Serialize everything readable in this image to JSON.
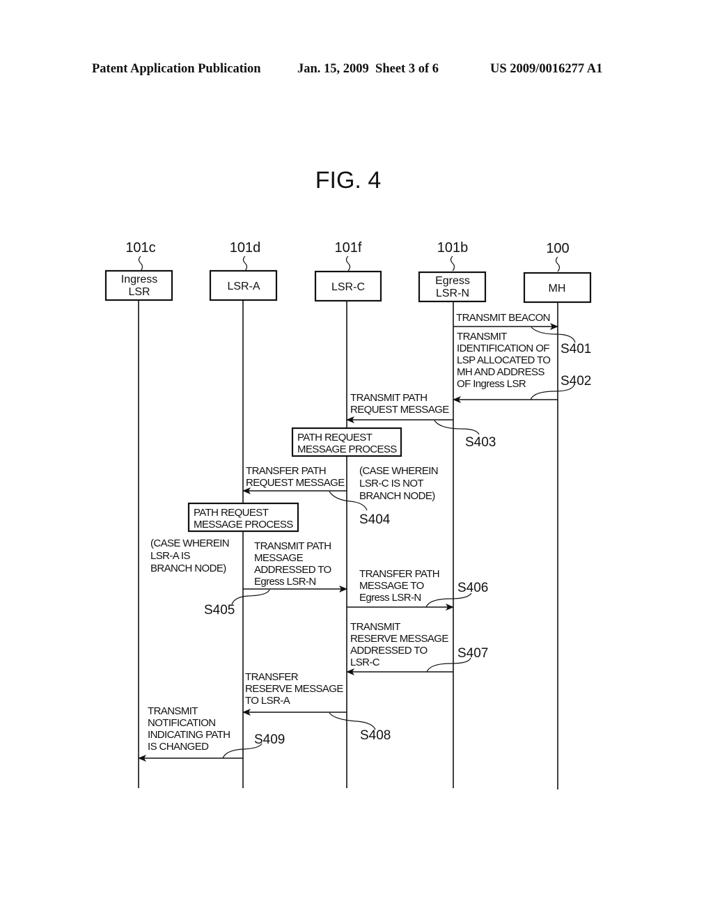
{
  "header": {
    "publication": "Patent Application Publication",
    "date_sheet": "Jan. 15, 2009  Sheet 3 of 6",
    "number": "US 2009/0016277 A1"
  },
  "figure": {
    "title": "FIG. 4"
  },
  "nodes": [
    {
      "ref": "101c",
      "lines": [
        "Ingress",
        "LSR"
      ]
    },
    {
      "ref": "101d",
      "lines": [
        "LSR-A"
      ]
    },
    {
      "ref": "101f",
      "lines": [
        "LSR-C"
      ]
    },
    {
      "ref": "101b",
      "lines": [
        "Egress",
        "LSR-N"
      ]
    },
    {
      "ref": "100",
      "lines": [
        "MH"
      ]
    }
  ],
  "messages": [
    {
      "step": "S401",
      "from": 3,
      "to": 4,
      "lines": [
        "TRANSMIT BEACON"
      ]
    },
    {
      "step": "S402",
      "from": 4,
      "to": 3,
      "lines": [
        "TRANSMIT",
        "IDENTIFICATION OF",
        "LSP ALLOCATED TO",
        "MH AND ADDRESS",
        "OF Ingress LSR"
      ]
    },
    {
      "step": "S403",
      "from": 3,
      "to": 2,
      "lines": [
        "TRANSMIT PATH",
        "REQUEST MESSAGE"
      ]
    },
    {
      "step": "S404",
      "from": 2,
      "to": 1,
      "lines": [
        "TRANSFER PATH",
        "REQUEST MESSAGE"
      ]
    },
    {
      "step": "S405",
      "from": 1,
      "to": 2,
      "lines": [
        "TRANSMIT PATH",
        "MESSAGE",
        "ADDRESSED TO",
        "Egress LSR-N"
      ]
    },
    {
      "step": "S406",
      "from": 2,
      "to": 3,
      "lines": [
        "TRANSFER PATH",
        "MESSAGE TO",
        "Egress LSR-N"
      ]
    },
    {
      "step": "S407",
      "from": 3,
      "to": 2,
      "lines": [
        "TRANSMIT",
        "RESERVE MESSAGE",
        "ADDRESSED TO",
        "LSR-C"
      ]
    },
    {
      "step": "S408",
      "from": 2,
      "to": 1,
      "lines": [
        "TRANSFER",
        "RESERVE MESSAGE",
        "TO LSR-A"
      ]
    },
    {
      "step": "S409",
      "from": 1,
      "to": 0,
      "lines": [
        "TRANSMIT",
        "NOTIFICATION",
        "INDICATING PATH",
        "IS CHANGED"
      ]
    }
  ],
  "processes": [
    {
      "node": 2,
      "lines": [
        "PATH REQUEST",
        "MESSAGE PROCESS"
      ]
    },
    {
      "node": 1,
      "lines": [
        "PATH REQUEST",
        "MESSAGE PROCESS"
      ]
    }
  ],
  "notes": [
    {
      "lines": [
        "(CASE WHEREIN",
        "LSR-C IS NOT",
        "BRANCH NODE)"
      ]
    },
    {
      "lines": [
        "(CASE WHEREIN",
        "LSR-A IS",
        "BRANCH NODE)"
      ]
    }
  ]
}
